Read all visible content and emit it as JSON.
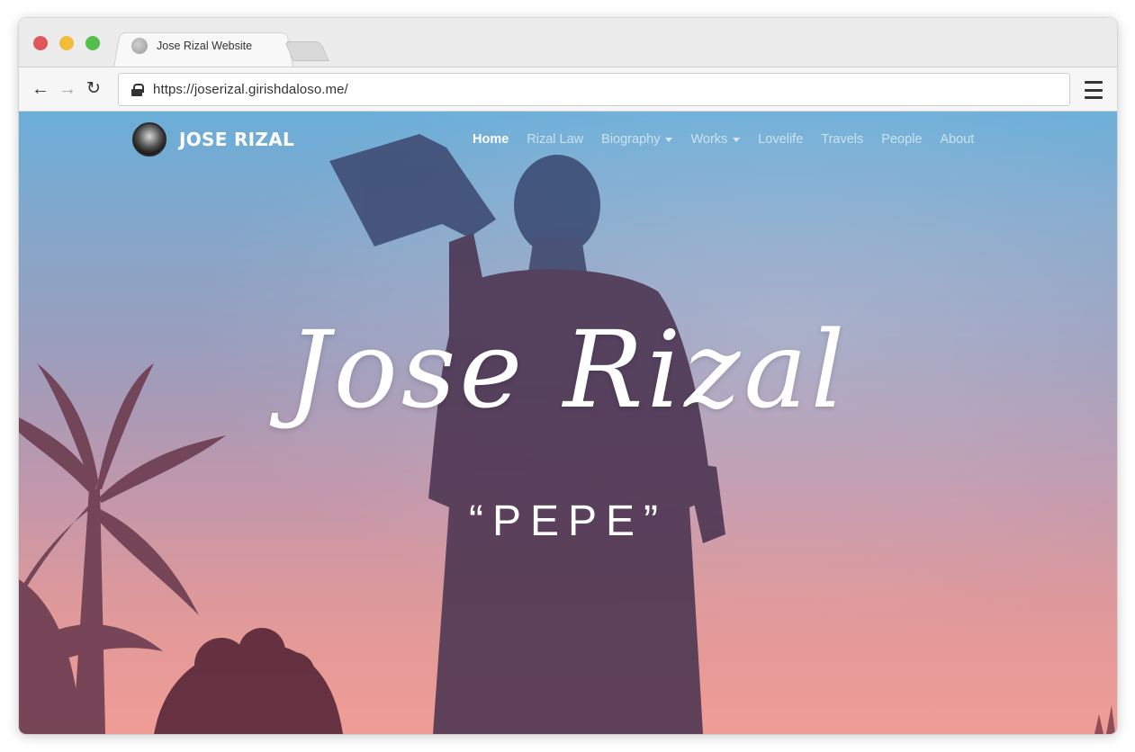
{
  "browser": {
    "tab_title": "Jose Rizal Website",
    "url": "https://joserizal.girishdaloso.me/"
  },
  "site": {
    "brand": "JOSE RIZAL",
    "nav": [
      {
        "label": "Home",
        "active": true,
        "dropdown": false
      },
      {
        "label": "Rizal Law",
        "active": false,
        "dropdown": false
      },
      {
        "label": "Biography",
        "active": false,
        "dropdown": true
      },
      {
        "label": "Works",
        "active": false,
        "dropdown": true
      },
      {
        "label": "Lovelife",
        "active": false,
        "dropdown": false
      },
      {
        "label": "Travels",
        "active": false,
        "dropdown": false
      },
      {
        "label": "People",
        "active": false,
        "dropdown": false
      },
      {
        "label": "About",
        "active": false,
        "dropdown": false
      }
    ]
  },
  "hero": {
    "title": "Jose Rizal",
    "subtitle": "“PEPE”"
  },
  "icons": {
    "back": "back-arrow-icon",
    "forward": "forward-arrow-icon",
    "reload": "reload-icon",
    "lock": "lock-icon",
    "menu": "hamburger-menu-icon"
  },
  "colors": {
    "traffic_red": "#e0575b",
    "traffic_yellow": "#f1be3a",
    "traffic_green": "#52c04a",
    "sky_top": "#6aaed8",
    "sky_bottom": "#f09c96"
  }
}
